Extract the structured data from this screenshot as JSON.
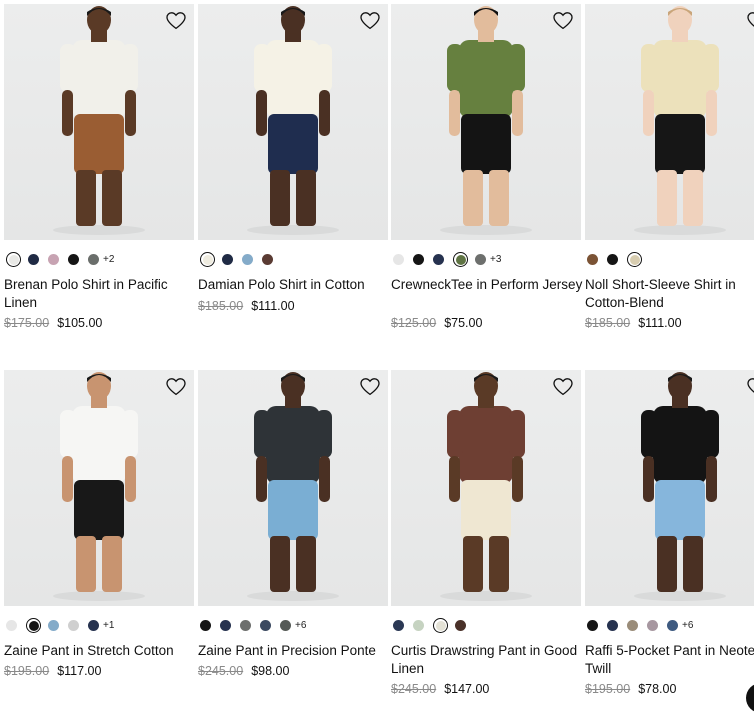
{
  "colors": {
    "accent": "#111111",
    "strike": "#8a8a8a"
  },
  "products": [
    {
      "name": "Brenan Polo Shirt in Pacific Linen",
      "old": "$175.00",
      "new": "$105.00",
      "swatches": [
        "#e9e9e6",
        "#1f2a44",
        "#c7a3b2",
        "#151515",
        "#6a6e6b"
      ],
      "selected": 0,
      "more": "+2",
      "top": "#f1f0ea",
      "bottom": "#9a5d33",
      "skin": "#5a3a26",
      "hair": "#1a1a1a"
    },
    {
      "name": "Damian Polo Shirt in Cotton",
      "old": "$185.00",
      "new": "$111.00",
      "swatches": [
        "#efece0",
        "#1f2a44",
        "#84abc9",
        "#5a3b33"
      ],
      "selected": 0,
      "more": "",
      "top": "#f5f2e6",
      "bottom": "#1f2d4f",
      "skin": "#4a3023",
      "hair": "#1a1a1a"
    },
    {
      "name": "CrewneckTee in Perform Jersey",
      "old": "$125.00",
      "new": "$75.00",
      "swatches": [
        "#e6e6e6",
        "#151515",
        "#26324f",
        "#5f7444",
        "#6d6f6d"
      ],
      "selected": 3,
      "more": "+3",
      "top": "#66803f",
      "bottom": "#141414",
      "skin": "#e2bc9c",
      "hair": "#111111"
    },
    {
      "name": "Noll Short-Sleeve Shirt in Cotton-Blend",
      "old": "$185.00",
      "new": "$111.00",
      "swatches": [
        "#7b5335",
        "#151515",
        "#d8cdb0"
      ],
      "selected": 2,
      "more": "",
      "top": "#ece1bb",
      "bottom": "#161616",
      "skin": "#f0d2bd",
      "hair": "#c9a57a"
    },
    {
      "name": "Zaine Pant in Stretch Cotton",
      "old": "$195.00",
      "new": "$117.00",
      "swatches": [
        "#e6e6e6",
        "#151515",
        "#84abc9",
        "#cfcfcf",
        "#26324f"
      ],
      "selected": 1,
      "more": "+1",
      "top": "#f6f6f4",
      "bottom": "#181818",
      "skin": "#c89470",
      "hair": "#1a1a1a"
    },
    {
      "name": "Zaine Pant in Precision Ponte",
      "old": "$245.00",
      "new": "$98.00",
      "swatches": [
        "#151515",
        "#26324f",
        "#6d6f6d",
        "#3b4960",
        "#555a56"
      ],
      "selected": -1,
      "more": "+6",
      "top": "#2e3337",
      "bottom": "#7aaed3",
      "skin": "#4a3023",
      "hair": "#1a1a1a"
    },
    {
      "name": "Curtis Drawstring Pant in Good Linen",
      "old": "$245.00",
      "new": "$147.00",
      "swatches": [
        "#2b3854",
        "#c6d3c1",
        "#e4e2d6",
        "#4a3129"
      ],
      "selected": 2,
      "more": "",
      "top": "#6e3f33",
      "bottom": "#efe7d2",
      "skin": "#5a3a26",
      "hair": "#1a1a1a"
    },
    {
      "name": "Raffi 5-Pocket Pant in Neoteric Twill",
      "old": "$195.00",
      "new": "$78.00",
      "swatches": [
        "#151515",
        "#26324f",
        "#9a8c79",
        "#a797a0",
        "#3e5a80"
      ],
      "selected": -1,
      "more": "+6",
      "top": "#141414",
      "bottom": "#86b6dc",
      "skin": "#4a3023",
      "hair": "#1a1a1a"
    }
  ]
}
